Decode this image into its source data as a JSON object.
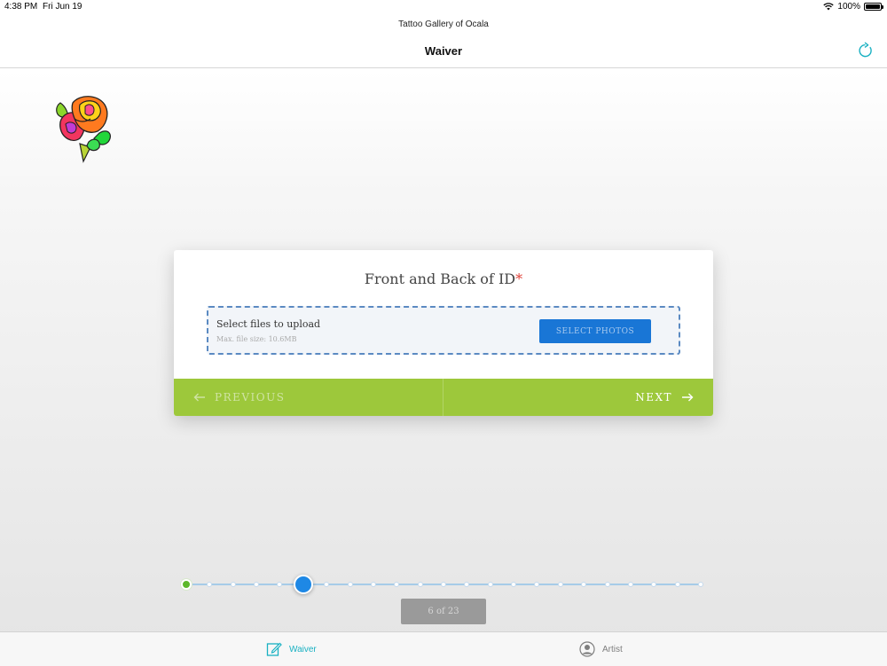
{
  "status_bar": {
    "time": "4:38 PM",
    "date": "Fri Jun 19",
    "battery": "100%",
    "battery_level": 1.0
  },
  "navbar": {
    "subtitle": "Tattoo Gallery of Ocala",
    "title": "Waiver"
  },
  "form": {
    "question": "Front and Back of ID",
    "required_mark": "*",
    "upload_label": "Select files to upload",
    "upload_hint": "Max. file size: 10.6MB",
    "select_button": "SELECT PHOTOS",
    "previous": "PREVIOUS",
    "next": "NEXT"
  },
  "progress": {
    "current": 6,
    "total": 23,
    "label": "6 of 23"
  },
  "tabs": [
    {
      "label": "Waiver",
      "active": true
    },
    {
      "label": "Artist",
      "active": false
    }
  ],
  "colors": {
    "accent": "#1ab1c2",
    "primary_button": "#1976d6",
    "nav_green": "#9dc83b",
    "required": "#e0433b",
    "step_done": "#5cb82a",
    "step_current": "#1e88e5"
  }
}
